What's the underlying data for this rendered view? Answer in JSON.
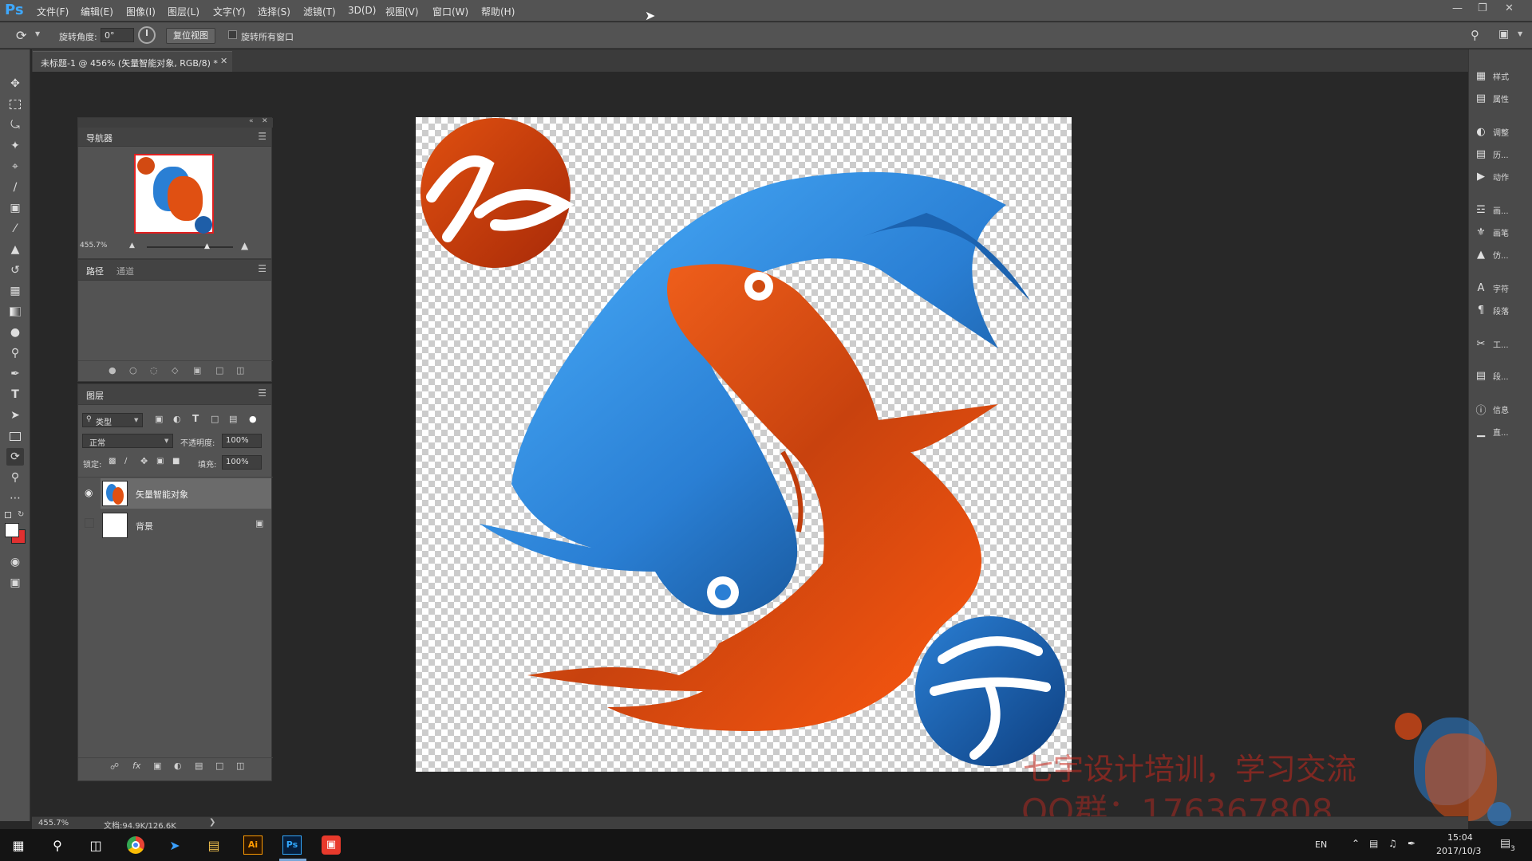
{
  "app": {
    "logo": "Ps",
    "menu": [
      "文件(F)",
      "编辑(E)",
      "图像(I)",
      "图层(L)",
      "文字(Y)",
      "选择(S)",
      "滤镜(T)",
      "3D(D)",
      "视图(V)",
      "窗口(W)",
      "帮助(H)"
    ],
    "window_controls": [
      "minimize-icon",
      "restore-icon",
      "close-icon"
    ]
  },
  "options": {
    "rotate_label": "旋转角度:",
    "rotate_value": "0°",
    "reset_view": "复位视图",
    "rotate_all": "旋转所有窗口",
    "rotate_all_checked": false
  },
  "document": {
    "tab_title": "未标题-1 @ 456% (矢量智能对象, RGB/8) *"
  },
  "toolbar": {
    "tools": [
      "move-icon",
      "marquee-icon",
      "lasso-icon",
      "magic-wand-icon",
      "crop-icon",
      "eyedropper-icon",
      "healing-brush-icon",
      "brush-icon",
      "clone-stamp-icon",
      "history-brush-icon",
      "eraser-icon",
      "gradient-icon",
      "blur-icon",
      "dodge-icon",
      "pen-icon",
      "type-icon",
      "path-selection-icon",
      "rectangle-icon",
      "rotate-view-icon",
      "zoom-icon",
      "more-tools-icon"
    ],
    "foreground_color": "#ffffff",
    "background_color": "#e03030"
  },
  "navigator": {
    "title": "导航器",
    "zoom": "455.7%"
  },
  "paths_panel": {
    "tabs": [
      "路径",
      "通道"
    ]
  },
  "layers_panel": {
    "title": "图层",
    "filter_kind": "类型",
    "blend_mode": "正常",
    "opacity_label": "不透明度:",
    "opacity_value": "100%",
    "lock_label": "锁定:",
    "fill_label": "填充:",
    "fill_value": "100%",
    "layers": [
      {
        "name": "矢量智能对象",
        "visible": true,
        "selected": true
      },
      {
        "name": "背景",
        "visible": false,
        "locked": true
      }
    ]
  },
  "right_dock": [
    {
      "icon": "styles-icon",
      "label": "样式"
    },
    {
      "icon": "properties-icon",
      "label": "属性"
    },
    {
      "icon": "adjustments-icon",
      "label": "调整"
    },
    {
      "icon": "history-icon",
      "label": "历..."
    },
    {
      "icon": "actions-icon",
      "label": "动作"
    },
    {
      "icon": "brush-settings-icon",
      "label": "画..."
    },
    {
      "icon": "brushes-icon",
      "label": "画笔"
    },
    {
      "icon": "clone-source-icon",
      "label": "仿..."
    },
    {
      "icon": "character-icon",
      "label": "字符"
    },
    {
      "icon": "paragraph-icon",
      "label": "段落"
    },
    {
      "icon": "tools-icon",
      "label": "工..."
    },
    {
      "icon": "layer-comps-icon",
      "label": "段..."
    },
    {
      "icon": "info-icon",
      "label": "信息"
    },
    {
      "icon": "histogram-icon",
      "label": "直..."
    }
  ],
  "status": {
    "zoom": "455.7%",
    "doc": "文档:94.9K/126.6K"
  },
  "watermark": {
    "line1": "七宇设计培训，学习交流",
    "line2": "QQ群：176367808"
  },
  "artwork": {
    "badge_top_left_char": "心",
    "badge_bottom_right_char": "字",
    "blue": "#2a7fd4",
    "orange": "#e8521c"
  },
  "taskbar": {
    "apps": [
      "windows-start-icon",
      "search-icon",
      "task-view-icon",
      "chrome-icon",
      "feishu-icon",
      "file-explorer-icon",
      "illustrator-icon",
      "photoshop-icon",
      "screen-recorder-icon"
    ],
    "illustrator_label": "Ai",
    "photoshop_label": "Ps",
    "lang": "EN",
    "time": "15:04",
    "date": "2017/10/3",
    "notification_count": "3"
  }
}
